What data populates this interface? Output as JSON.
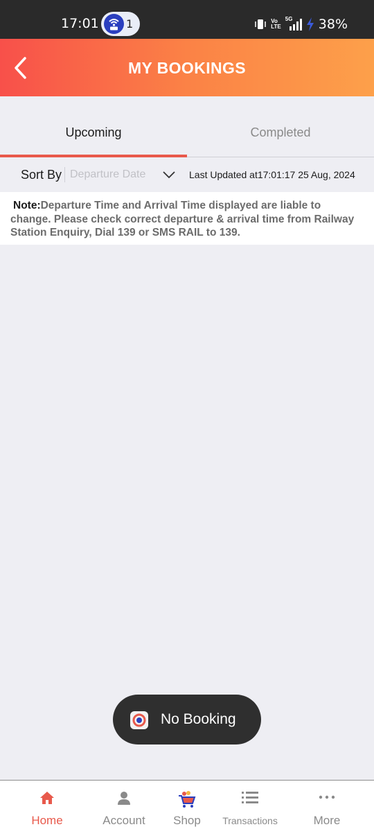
{
  "status_bar": {
    "time": "17:01",
    "hotspot_count": "1",
    "battery": "38%",
    "volte_top": "Vo",
    "volte_bottom": "LTE",
    "net": "5G"
  },
  "header": {
    "title": "MY BOOKINGS"
  },
  "tabs": [
    {
      "label": "Upcoming"
    },
    {
      "label": "Completed"
    }
  ],
  "sort": {
    "label": "Sort By",
    "placeholder": "Departure Date",
    "last_updated": "Last Updated at17:01:17 25 Aug, 2024"
  },
  "note": {
    "label": "Note:",
    "text": "Departure Time and Arrival Time displayed are liable to change. Please check correct departure & arrival time from Railway Station Enquiry, Dial 139 or SMS RAIL to 139."
  },
  "toast": {
    "text": "No Booking"
  },
  "bottom_nav": [
    {
      "label": "Home"
    },
    {
      "label": "Account"
    },
    {
      "label": "Shop"
    },
    {
      "label": "Transactions"
    },
    {
      "label": "More"
    }
  ],
  "colors": {
    "accent": "#e8594b",
    "header_start": "#f8504a",
    "header_end": "#fda04a"
  }
}
